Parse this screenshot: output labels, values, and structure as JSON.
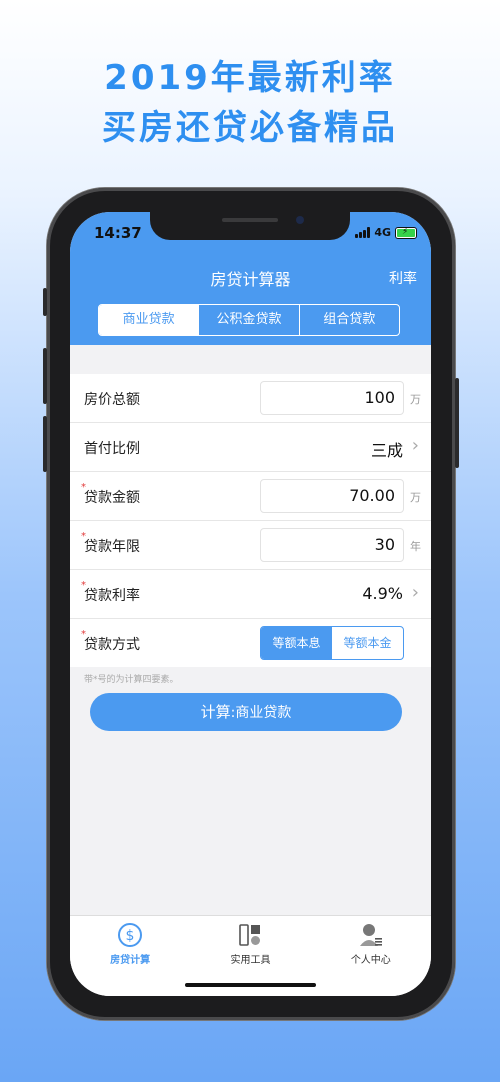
{
  "promo": {
    "line1": "2019年最新利率",
    "line2": "买房还贷必备精品"
  },
  "status_bar": {
    "time": "14:37",
    "network": "4G"
  },
  "nav": {
    "title": "房贷计算器",
    "right_action": "利率"
  },
  "loan_types": [
    {
      "label": "商业贷款",
      "active": true
    },
    {
      "label": "公积金贷款",
      "active": false
    },
    {
      "label": "组合贷款",
      "active": false
    }
  ],
  "form": {
    "house_price": {
      "label": "房价总额",
      "value": "100",
      "unit": "万"
    },
    "down_payment": {
      "label": "首付比例",
      "value": "三成"
    },
    "loan_amount": {
      "label": "贷款金额",
      "value": "70.00",
      "unit": "万",
      "required_mark": "*"
    },
    "loan_term": {
      "label": "贷款年限",
      "value": "30",
      "unit": "年",
      "required_mark": "*"
    },
    "rate": {
      "label": "贷款利率",
      "value": "4.9%",
      "required_mark": "*"
    },
    "method": {
      "label": "贷款方式",
      "required_mark": "*",
      "options": [
        "等额本息",
        "等额本金"
      ],
      "selected": "等额本息"
    }
  },
  "note": "带*号的为计算四要素。",
  "calc_button": {
    "prefix": "计算",
    "suffix": ":商业贷款"
  },
  "tabs": [
    {
      "label": "房贷计算",
      "icon": "dollar-circle-icon",
      "active": true
    },
    {
      "label": "实用工具",
      "icon": "tools-icon",
      "active": false
    },
    {
      "label": "个人中心",
      "icon": "user-icon",
      "active": false
    }
  ],
  "colors": {
    "primary": "#4b9af0",
    "promo_text": "#2e8ff0",
    "required": "#e23b3b"
  }
}
